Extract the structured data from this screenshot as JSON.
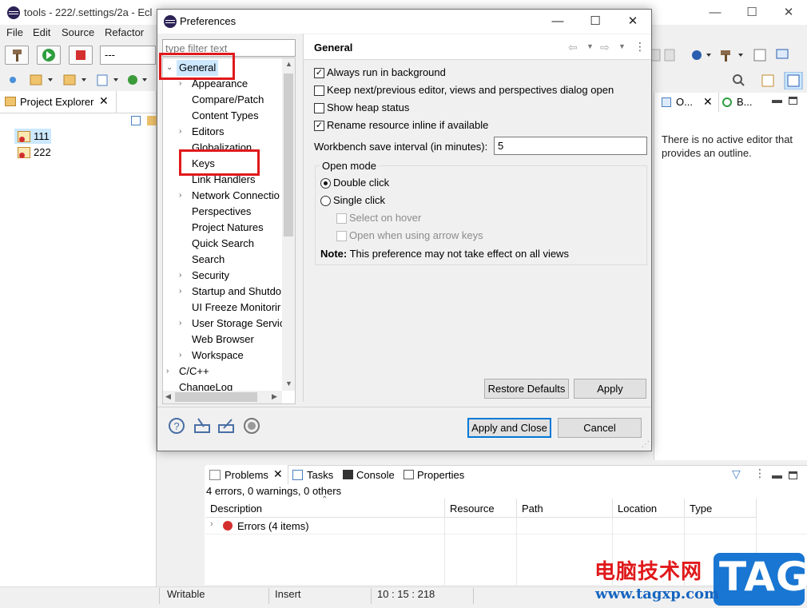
{
  "main_window": {
    "title": "tools - 222/.settings/2a - Ecl",
    "menu": [
      "File",
      "Edit",
      "Source",
      "Refactor"
    ],
    "run_config_value": "---",
    "minimize_glyph": "—",
    "maximize_glyph": "☐",
    "close_glyph": "✕"
  },
  "project_explorer": {
    "tab_label": "Project Explorer",
    "projects": [
      "111",
      "222"
    ]
  },
  "outline": {
    "tab1_label": "O...",
    "tab2_label": "B...",
    "message": "There is no active editor that provides an outline."
  },
  "problems_view": {
    "tabs": [
      "Problems",
      "Tasks",
      "Console",
      "Properties"
    ],
    "summary": "4 errors, 0 warnings, 0 others",
    "columns": [
      "Description",
      "Resource",
      "Path",
      "Location",
      "Type"
    ],
    "rows": [
      {
        "description": "Errors (4 items)"
      }
    ]
  },
  "status_bar": {
    "mode": "Writable",
    "insert": "Insert",
    "position": "10 : 15 : 218"
  },
  "preferences": {
    "title": "Preferences",
    "filter_placeholder": "type filter text",
    "tree": [
      {
        "label": "General",
        "level": 0,
        "expanded": true,
        "selected": true,
        "has_children": true
      },
      {
        "label": "Appearance",
        "level": 1,
        "has_children": true
      },
      {
        "label": "Compare/Patch",
        "level": 1
      },
      {
        "label": "Content Types",
        "level": 1
      },
      {
        "label": "Editors",
        "level": 1,
        "has_children": true
      },
      {
        "label": "Globalization",
        "level": 1
      },
      {
        "label": "Keys",
        "level": 1
      },
      {
        "label": "Link Handlers",
        "level": 1
      },
      {
        "label": "Network Connectio",
        "level": 1,
        "has_children": true
      },
      {
        "label": "Perspectives",
        "level": 1
      },
      {
        "label": "Project Natures",
        "level": 1
      },
      {
        "label": "Quick Search",
        "level": 1
      },
      {
        "label": "Search",
        "level": 1
      },
      {
        "label": "Security",
        "level": 1,
        "has_children": true
      },
      {
        "label": "Startup and Shutdo",
        "level": 1,
        "has_children": true
      },
      {
        "label": "UI Freeze Monitorir",
        "level": 1
      },
      {
        "label": "User Storage Servic",
        "level": 1,
        "has_children": true
      },
      {
        "label": "Web Browser",
        "level": 1
      },
      {
        "label": "Workspace",
        "level": 1,
        "has_children": true
      },
      {
        "label": "C/C++",
        "level": 0,
        "has_children": true
      },
      {
        "label": "ChangeLog",
        "level": 0
      }
    ],
    "page": {
      "title": "General",
      "options": [
        {
          "label": "Always run in background",
          "checked": true
        },
        {
          "label": "Keep next/previous editor, views and perspectives dialog open",
          "checked": false
        },
        {
          "label": "Show heap status",
          "checked": false
        },
        {
          "label": "Rename resource inline if available",
          "checked": true
        }
      ],
      "save_interval_label": "Workbench save interval (in minutes):",
      "save_interval_value": "5",
      "open_mode": {
        "title": "Open mode",
        "double_click": "Double click",
        "single_click": "Single click",
        "select_on_hover": "Select on hover",
        "open_with_arrow_keys": "Open when using arrow keys",
        "selected": "Double click"
      },
      "note_label": "Note:",
      "note_text": "This preference may not take effect on all views"
    },
    "buttons": {
      "restore_defaults": "Restore Defaults",
      "apply": "Apply",
      "apply_and_close": "Apply and Close",
      "cancel": "Cancel"
    }
  },
  "watermark": {
    "site_name": "电脑技术网",
    "url": "www.tagxp.com",
    "badge": "TAG"
  },
  "colors": {
    "selection": "#cce8ff",
    "annotation_red": "#e0191b",
    "default_button_border": "#0078d7"
  }
}
